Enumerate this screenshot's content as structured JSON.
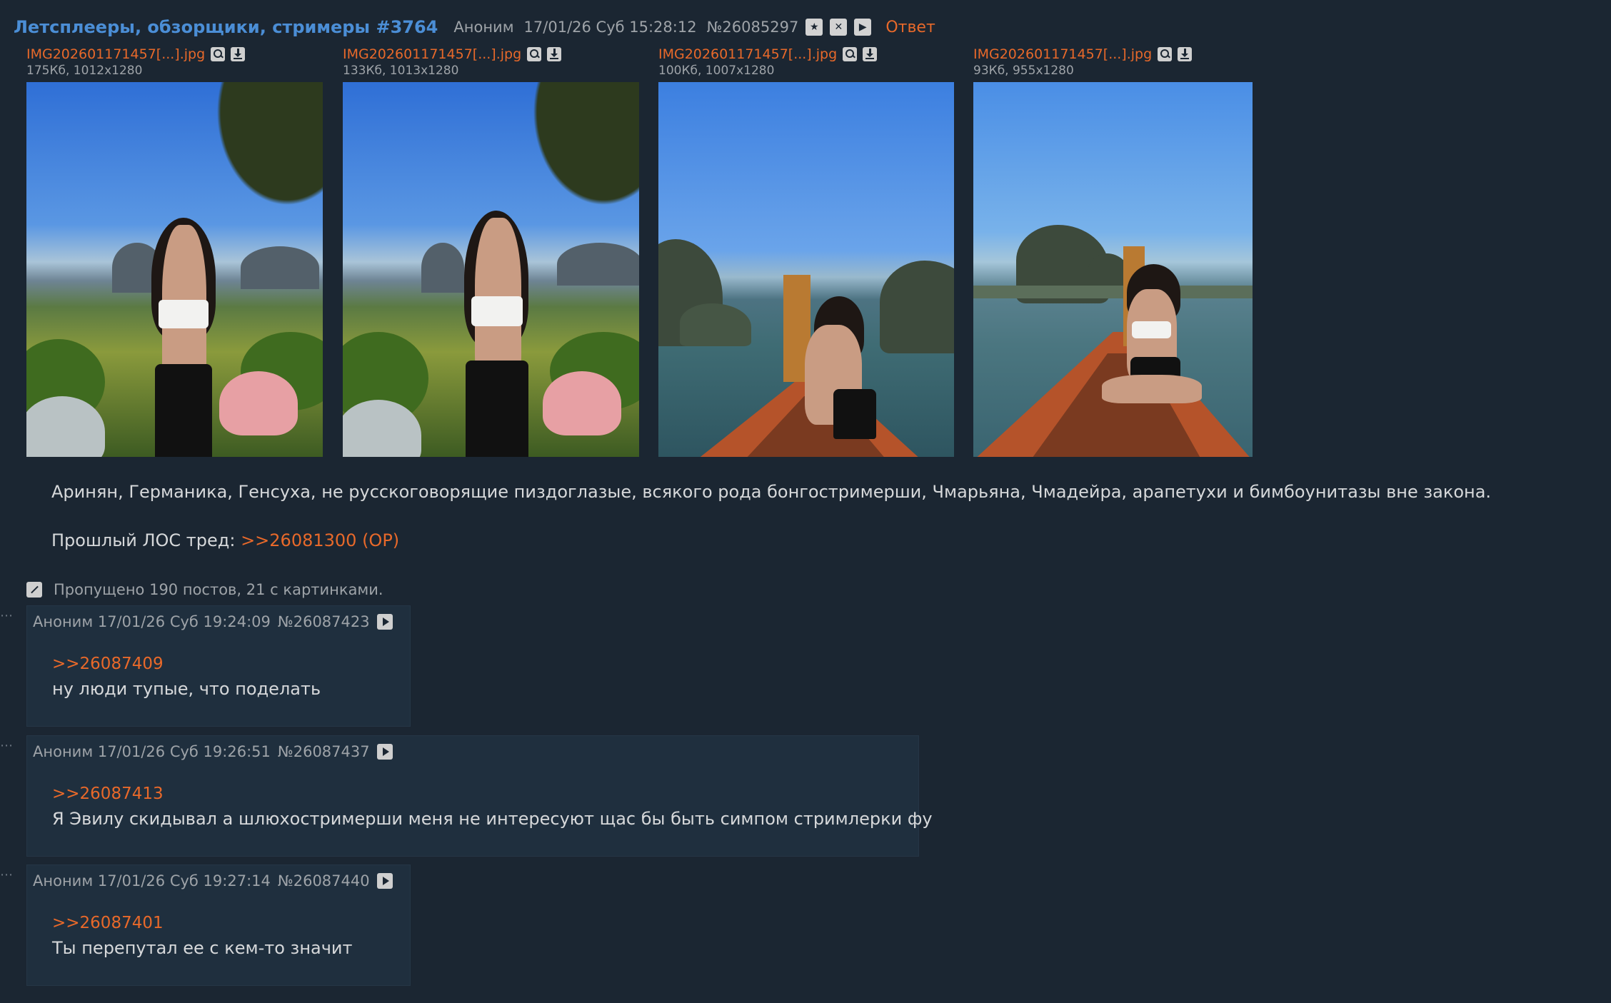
{
  "op": {
    "thread_title": "Летсплееры, обзорщики, стримеры #3764",
    "author": "Аноним",
    "datetime": "17/01/26 Суб 15:28:12",
    "post_number": "№26085297",
    "reply_label": "Ответ",
    "files": [
      {
        "name": "IMG202601171457[...].jpg",
        "info": "175Кб, 1012x1280"
      },
      {
        "name": "IMG202601171457[...].jpg",
        "info": "133Кб, 1013x1280"
      },
      {
        "name": "IMG202601171457[...].jpg",
        "info": "100Кб, 1007x1280"
      },
      {
        "name": "IMG202601171457[...].jpg",
        "info": "93Кб, 955x1280"
      }
    ],
    "text_line1": "Аринян, Германика, Генсуха, не русскоговорящие пиздоглазые, всякого рода бонгостримерши, Чмарьяна, Чмадейра, арапетухи и бимбоунитазы вне закона.",
    "text_line2_prefix": "Прошлый ЛОС тред: ",
    "text_line2_link": ">>26081300 (OP)"
  },
  "skipped": "Пропущено 190 постов, 21 с картинками.",
  "replies": [
    {
      "author_datetime": "Аноним 17/01/26 Суб 19:24:09",
      "number": "№26087423",
      "quote": ">>26087409",
      "text": "ну люди тупые, что поделать"
    },
    {
      "author_datetime": "Аноним 17/01/26 Суб 19:26:51",
      "number": "№26087437",
      "quote": ">>26087413",
      "text": "Я Эвилу скидывал а шлюхостримерши меня не интересуют щас бы быть симпом стримлерки фу"
    },
    {
      "author_datetime": "Аноним 17/01/26 Суб 19:27:14",
      "number": "№26087440",
      "quote": ">>26087401",
      "text": "Ты перепутал ее с кем-то значит"
    }
  ],
  "icons": {
    "star": "star-icon",
    "close": "close-icon",
    "play": "play-icon",
    "search": "search-icon",
    "download": "download-icon",
    "expand": "expand-icon"
  },
  "colors": {
    "background": "#1b2632",
    "link": "#e8692a",
    "title": "#4b8ed6",
    "meta": "#9ea3a8",
    "reply_bg": "#1f2f3e"
  }
}
